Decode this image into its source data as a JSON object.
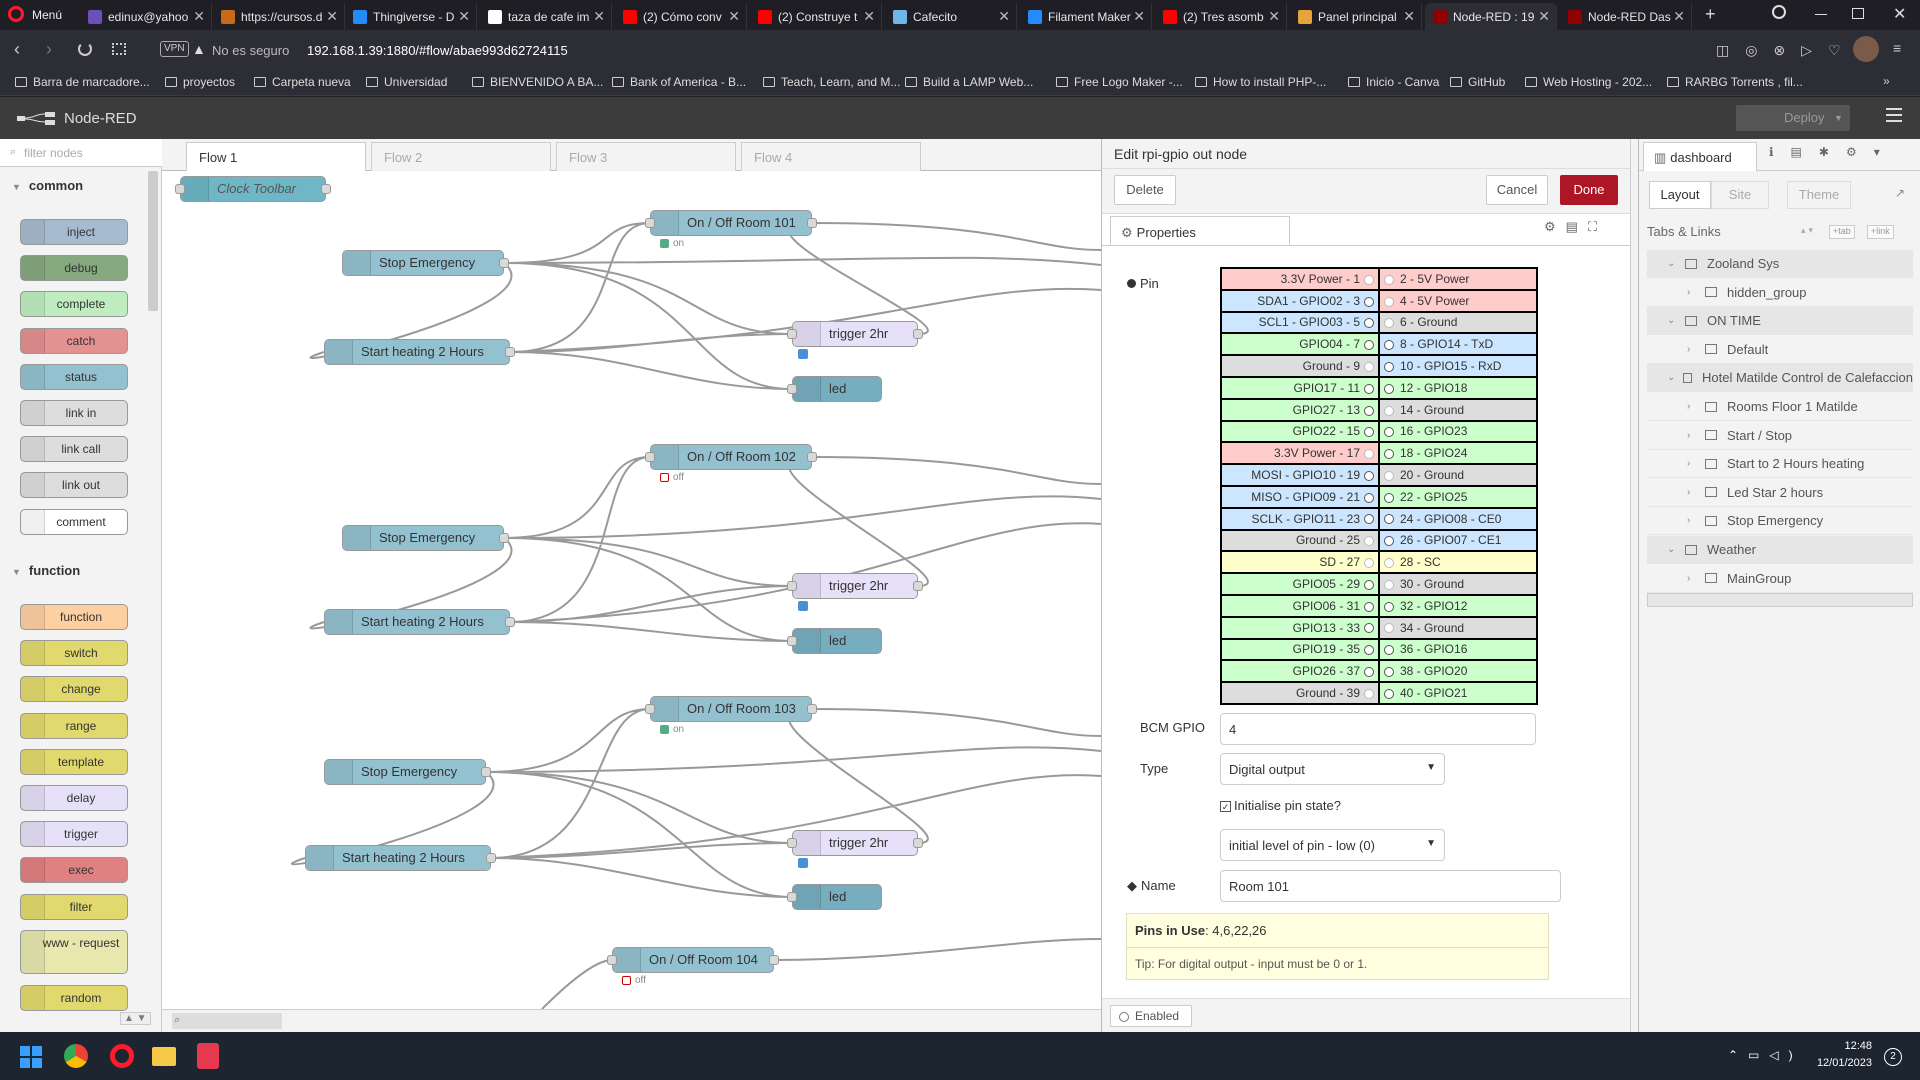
{
  "browser": {
    "menu_label": "Menú",
    "tabs": [
      {
        "title": "edinux@yahoo",
        "fav": "#6b4fbb"
      },
      {
        "title": "https://cursos.d",
        "fav": "#c76a1a"
      },
      {
        "title": "Thingiverse - D",
        "fav": "#248bfb"
      },
      {
        "title": "taza de cafe im",
        "fav": "#ffffff"
      },
      {
        "title": "(2) Cómo conv",
        "fav": "#ff0000"
      },
      {
        "title": "(2) Construye t",
        "fav": "#ff0000"
      },
      {
        "title": "Cafecito",
        "fav": "#6fb7e9"
      },
      {
        "title": "Filament Maker",
        "fav": "#248bfb"
      },
      {
        "title": "(2) Tres asomb",
        "fav": "#ff0000"
      },
      {
        "title": "Panel principal",
        "fav": "#e8a43c"
      },
      {
        "title": "Node-RED : 19",
        "fav": "#8f0000"
      },
      {
        "title": "Node-RED Das",
        "fav": "#8f0000"
      }
    ],
    "security_label": "No es seguro",
    "url": "192.168.1.39:1880/#flow/abae993d62724115",
    "vpn_label": "VPN",
    "bookmarks": [
      "Barra de marcadore...",
      "proyectos",
      "Carpeta nueva",
      "Universidad",
      "BIENVENIDO A BA...",
      "Bank of America - B...",
      "Teach, Learn, and M...",
      "Build a LAMP Web...",
      "Free Logo Maker -...",
      "How to install PHP-...",
      "Inicio - Canva",
      "GitHub",
      "Web Hosting - 202...",
      "RARBG Torrents , fil..."
    ]
  },
  "nodered": {
    "title": "Node-RED",
    "deploy_label": "Deploy",
    "filter_placeholder": "filter nodes",
    "palette": {
      "categories": [
        "common",
        "function"
      ],
      "common": [
        {
          "label": "inject",
          "color": "#a6bbcf"
        },
        {
          "label": "debug",
          "color": "#87a980"
        },
        {
          "label": "complete",
          "color": "#c0edc0"
        },
        {
          "label": "catch",
          "color": "#e49191"
        },
        {
          "label": "status",
          "color": "#94c1d0"
        },
        {
          "label": "link in",
          "color": "#dddddd"
        },
        {
          "label": "link call",
          "color": "#dddddd"
        },
        {
          "label": "link out",
          "color": "#dddddd"
        },
        {
          "label": "comment",
          "color": "#ffffff"
        }
      ],
      "function": [
        {
          "label": "function",
          "color": "#fdd0a2"
        },
        {
          "label": "switch",
          "color": "#e2d96e"
        },
        {
          "label": "change",
          "color": "#e2d96e"
        },
        {
          "label": "range",
          "color": "#e2d96e"
        },
        {
          "label": "template",
          "color": "#e2d96e"
        },
        {
          "label": "delay",
          "color": "#e6e0f8"
        },
        {
          "label": "trigger",
          "color": "#e6e0f8"
        },
        {
          "label": "exec",
          "color": "#e08080"
        },
        {
          "label": "filter",
          "color": "#e2d96e"
        },
        {
          "label": "www - request",
          "color": "#e7e7ae"
        },
        {
          "label": "random",
          "color": "#e2d96e"
        }
      ]
    },
    "workspace_tabs": [
      "Flow 1",
      "Flow 2",
      "Flow 3",
      "Flow 4"
    ],
    "flow_nodes": {
      "clock": "Clock Toolbar",
      "onoff": [
        "On / Off Room 101",
        "On / Off Room 102",
        "On / Off Room 103",
        "On / Off Room 104"
      ],
      "onoff_status": [
        "on",
        "off",
        "on",
        "off"
      ],
      "stop": "Stop Emergency",
      "start": "Start heating 2 Hours",
      "trigger": "trigger 2hr",
      "led": "led"
    },
    "edit": {
      "title": "Edit rpi-gpio out node",
      "delete_label": "Delete",
      "cancel_label": "Cancel",
      "done_label": "Done",
      "properties_tab": "Properties",
      "pin_label": "Pin",
      "pins": [
        [
          "3.3V Power - 1",
          "2 - 5V Power",
          "red",
          "red",
          0,
          0
        ],
        [
          "SDA1 - GPIO02 - 3",
          "4 - 5V Power",
          "blue",
          "red",
          1,
          0
        ],
        [
          "SCL1 - GPIO03 - 5",
          "6 - Ground",
          "blue",
          "grey",
          1,
          0
        ],
        [
          "GPIO04 - 7",
          "8 - GPIO14 - TxD",
          "green",
          "blue",
          1,
          1
        ],
        [
          "Ground - 9",
          "10 - GPIO15 - RxD",
          "grey",
          "blue",
          0,
          1
        ],
        [
          "GPIO17 - 11",
          "12 - GPIO18",
          "green",
          "green",
          1,
          1
        ],
        [
          "GPIO27 - 13",
          "14 - Ground",
          "green",
          "grey",
          1,
          0
        ],
        [
          "GPIO22 - 15",
          "16 - GPIO23",
          "green",
          "green",
          1,
          1
        ],
        [
          "3.3V Power - 17",
          "18 - GPIO24",
          "red",
          "green",
          0,
          1
        ],
        [
          "MOSI - GPIO10 - 19",
          "20 - Ground",
          "blue",
          "grey",
          1,
          0
        ],
        [
          "MISO - GPIO09 - 21",
          "22 - GPIO25",
          "blue",
          "green",
          1,
          1
        ],
        [
          "SCLK - GPIO11 - 23",
          "24 - GPIO08 - CE0",
          "blue",
          "blue",
          1,
          1
        ],
        [
          "Ground - 25",
          "26 - GPIO07 - CE1",
          "grey",
          "blue",
          0,
          1
        ],
        [
          "SD - 27",
          "28 - SC",
          "yel",
          "yel",
          0,
          0
        ],
        [
          "GPIO05 - 29",
          "30 - Ground",
          "green",
          "grey",
          1,
          0
        ],
        [
          "GPIO06 - 31",
          "32 - GPIO12",
          "green",
          "green",
          1,
          1
        ],
        [
          "GPIO13 - 33",
          "34 - Ground",
          "green",
          "grey",
          1,
          0
        ],
        [
          "GPIO19 - 35",
          "36 - GPIO16",
          "green",
          "green",
          1,
          1
        ],
        [
          "GPIO26 - 37",
          "38 - GPIO20",
          "green",
          "green",
          1,
          1
        ],
        [
          "Ground - 39",
          "40 - GPIO21",
          "grey",
          "green",
          0,
          1
        ]
      ],
      "bcm_label": "BCM GPIO",
      "bcm_value": "4",
      "type_label": "Type",
      "type_value": "Digital output",
      "init_label": "Initialise pin state?",
      "init_level": "initial level of pin - low (0)",
      "name_label": "Name",
      "name_value": "Room 101",
      "pins_in_use_label": "Pins in Use",
      "pins_in_use_value": ": 4,6,22,26",
      "tip": "Tip: For digital output - input must be 0 or 1.",
      "enabled_label": "Enabled"
    },
    "sidebar": {
      "tab_label": "dashboard",
      "subtabs": [
        "Layout",
        "Site",
        "Theme"
      ],
      "section": "Tabs & Links",
      "tab_btn": "+tab",
      "link_btn": "+link",
      "tree": [
        {
          "label": "Zooland Sys",
          "level": 0
        },
        {
          "label": "hidden_group",
          "level": 1
        },
        {
          "label": "ON TIME",
          "level": 0
        },
        {
          "label": "Default",
          "level": 1
        },
        {
          "label": "Hotel Matilde Control de Calefaccion",
          "level": 0
        },
        {
          "label": "Rooms Floor 1 Matilde",
          "level": 1
        },
        {
          "label": "Start / Stop",
          "level": 1
        },
        {
          "label": "Start to 2 Hours heating",
          "level": 1
        },
        {
          "label": "Led Star 2 hours",
          "level": 1
        },
        {
          "label": "Stop Emergency",
          "level": 1
        },
        {
          "label": "Weather",
          "level": 0
        },
        {
          "label": "MainGroup",
          "level": 1
        }
      ]
    }
  },
  "taskbar": {
    "time": "12:48",
    "date": "12/01/2023",
    "notifications": "2"
  }
}
